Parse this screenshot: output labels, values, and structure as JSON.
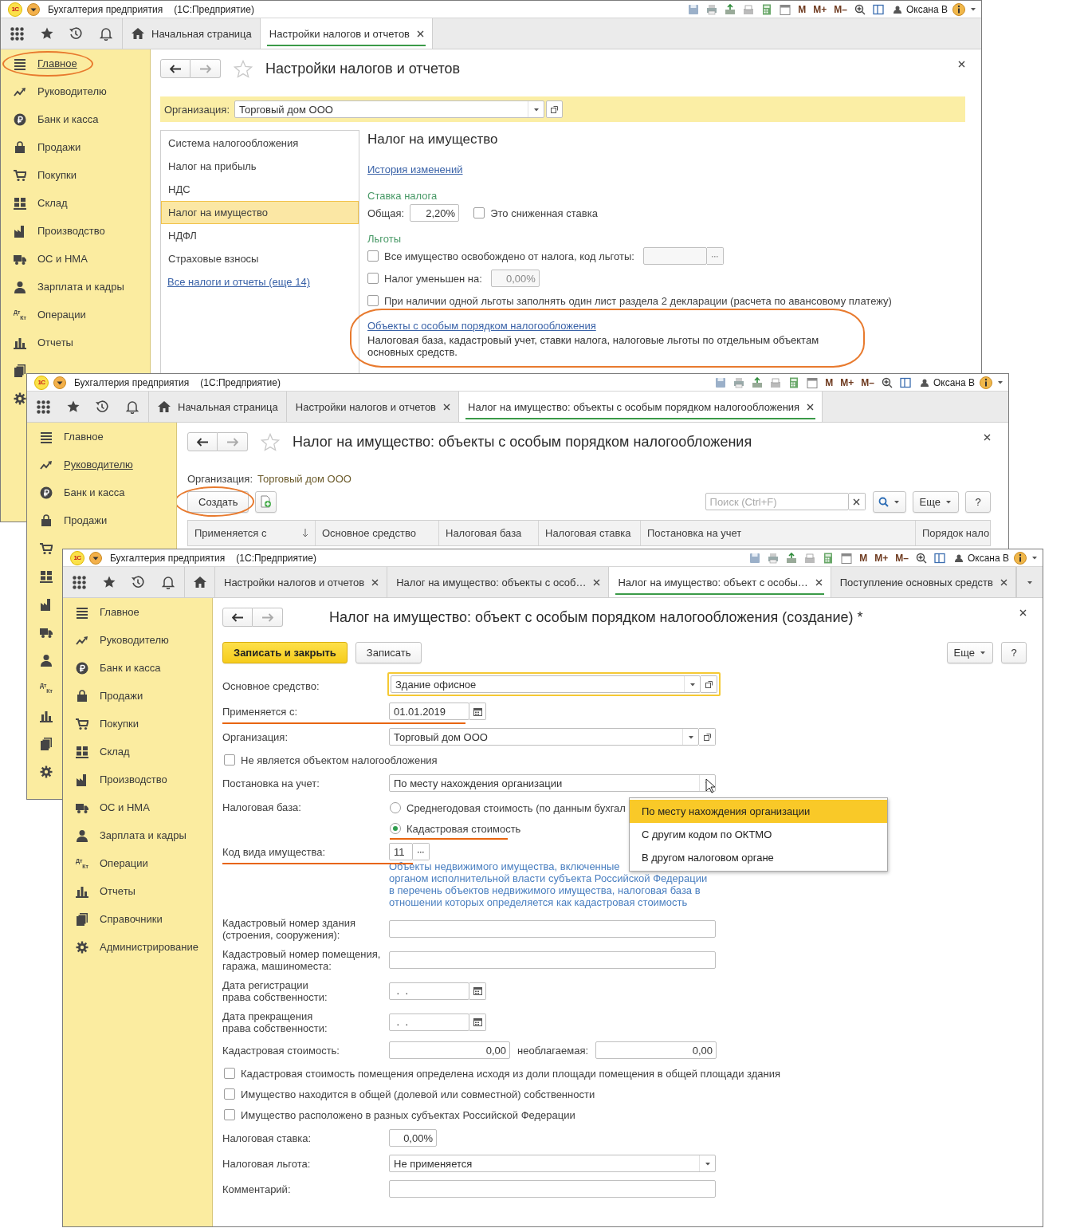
{
  "windows": [
    {
      "logo": "1С",
      "app_name": "Бухгалтерия предприятия",
      "platform": "(1С:Предприятие)",
      "memory_buttons": [
        "M",
        "M+",
        "M–"
      ],
      "user": "Оксана В",
      "tabs": [
        {
          "kind": "home",
          "label": "Начальная страница",
          "selected": false
        },
        {
          "kind": "page",
          "label": "Настройки налогов и отчетов",
          "selected": true,
          "closable": true
        }
      ],
      "sidebar": [
        {
          "kind": "main",
          "label": "Главное",
          "selected": true,
          "highlighted": true
        },
        {
          "kind": "director",
          "label": "Руководителю",
          "selected": false,
          "highlighted": false
        },
        {
          "kind": "bank",
          "label": "Банк и касса",
          "selected": false,
          "highlighted": false
        },
        {
          "kind": "sales",
          "label": "Продажи",
          "selected": false,
          "highlighted": false
        },
        {
          "kind": "purchases",
          "label": "Покупки",
          "selected": false,
          "highlighted": false
        },
        {
          "kind": "warehouse",
          "label": "Склад",
          "selected": false,
          "highlighted": false
        },
        {
          "kind": "production",
          "label": "Производство",
          "selected": false,
          "highlighted": false
        },
        {
          "kind": "assets",
          "label": "ОС и НМА",
          "selected": false,
          "highlighted": false
        },
        {
          "kind": "salary",
          "label": "Зарплата и кадры",
          "selected": false,
          "highlighted": false
        },
        {
          "kind": "operations",
          "icon_text": [
            "Дт",
            "Кт"
          ],
          "label": "Операции",
          "selected": false,
          "highlighted": false
        },
        {
          "kind": "reports",
          "label": "Отчеты",
          "selected": false,
          "highlighted": false
        },
        {
          "kind": "catalogs",
          "selected": false,
          "highlighted": false
        },
        {
          "kind": "admin",
          "selected": false,
          "highlighted": false
        }
      ],
      "content": {
        "kind": "settings",
        "title": "Настройки налогов и отчетов",
        "favorite_star": true,
        "org_label": "Организация:",
        "org_value": "Торговый дом ООО",
        "nav": [
          {
            "label": "Система налогообложения",
            "selected": false
          },
          {
            "label": "Налог на прибыль",
            "selected": false
          },
          {
            "label": "НДС",
            "selected": false
          },
          {
            "label": "Налог на имущество",
            "selected": true
          },
          {
            "label": "НДФЛ",
            "selected": false
          },
          {
            "label": "Страховые взносы",
            "selected": false
          }
        ],
        "nav_link": "Все налоги и отчеты (еще 14)",
        "section_title": "Налог на имущество",
        "history_link": "История изменений",
        "rate_group": "Ставка налога",
        "rate_label": "Общая:",
        "rate_value": "2,20%",
        "reduced": {
          "label": "Это сниженная ставка",
          "checked": false
        },
        "benefits_group": "Льготы",
        "exempt": {
          "label": "Все имущество освобождено от налога, код льготы:",
          "checked": false
        },
        "reduced_by": {
          "label": "Налог уменьшен на:",
          "checked": false,
          "value": "0,00%"
        },
        "single_sheet": {
          "label": "При наличии одной льготы заполнять один лист раздела 2 декларации (расчета по авансовому платежу)",
          "checked": false
        },
        "objects_link": "Объекты с особым порядком налогообложения",
        "objects_note": "Налоговая база, кадастровый учет, ставки налога, налоговые льготы по отдельным объектам основных средств.",
        "objects_highlighted": true
      }
    },
    {
      "logo": "1С",
      "app_name": "Бухгалтерия предприятия",
      "platform": "(1С:Предприятие)",
      "memory_buttons": [
        "M",
        "M+",
        "M–"
      ],
      "user": "Оксана В",
      "tabs": [
        {
          "kind": "home",
          "label": "Начальная страница",
          "selected": false
        },
        {
          "kind": "page",
          "label": "Настройки налогов и отчетов",
          "selected": false,
          "closable": true
        },
        {
          "kind": "page",
          "label": "Налог на имущество: объекты с особым порядком налогообложения",
          "selected": true,
          "closable": true
        }
      ],
      "sidebar": [
        {
          "kind": "main",
          "label": "Главное",
          "selected": false,
          "highlighted": false
        },
        {
          "kind": "director",
          "label": "Руководителю",
          "selected": true,
          "highlighted": false
        },
        {
          "kind": "bank",
          "label": "Банк и касса",
          "selected": false,
          "highlighted": false
        },
        {
          "kind": "sales",
          "label": "Продажи",
          "selected": false,
          "highlighted": false
        },
        {
          "kind": "purchases",
          "selected": false,
          "highlighted": false
        },
        {
          "kind": "warehouse",
          "selected": false,
          "highlighted": false
        },
        {
          "kind": "production",
          "selected": false,
          "highlighted": false
        },
        {
          "kind": "assets",
          "selected": false,
          "highlighted": false
        },
        {
          "kind": "salary",
          "selected": false,
          "highlighted": false
        },
        {
          "kind": "operations",
          "icon_text": [
            "Дт",
            "Кт"
          ],
          "selected": false,
          "highlighted": false
        },
        {
          "kind": "reports",
          "selected": false,
          "highlighted": false
        },
        {
          "kind": "catalogs",
          "selected": false,
          "highlighted": false
        },
        {
          "kind": "admin",
          "selected": false,
          "highlighted": false
        }
      ],
      "content": {
        "kind": "list",
        "title": "Налог на имущество: объекты с особым порядком налогообложения",
        "favorite_star": true,
        "org_label": "Организация:",
        "org_value": "Торговый дом ООО",
        "create_button": "Создать",
        "create_highlighted": true,
        "search_placeholder": "Поиск (Ctrl+F)",
        "more_button": "Еще",
        "help_button": "?",
        "columns": [
          {
            "label": "Применяется с",
            "sorted": true
          },
          {
            "label": "Основное средство",
            "sorted": false
          },
          {
            "label": "Налоговая база",
            "sorted": false
          },
          {
            "label": "Налоговая ставка",
            "sorted": false
          },
          {
            "label": "Постановка на учет",
            "sorted": false
          },
          {
            "label": "Порядок нало",
            "sorted": false
          }
        ]
      }
    },
    {
      "logo": "1С",
      "app_name": "Бухгалтерия предприятия",
      "platform": "(1С:Предприятие)",
      "memory_buttons": [
        "M",
        "M+",
        "M–"
      ],
      "user": "Оксана В",
      "tabs": [
        {
          "kind": "home",
          "selected": false
        },
        {
          "kind": "page",
          "label": "Настройки налогов и отчетов",
          "selected": false,
          "closable": true
        },
        {
          "kind": "page",
          "label": "Налог на имущество: объекты с особ…",
          "selected": false,
          "closable": true
        },
        {
          "kind": "page",
          "label": "Налог на имущество: объект с особы…",
          "selected": true,
          "closable": true
        },
        {
          "kind": "page",
          "label": "Поступление основных средств",
          "selected": false,
          "closable": true
        },
        {
          "kind": "menu"
        }
      ],
      "sidebar": [
        {
          "kind": "main",
          "label": "Главное",
          "selected": false,
          "highlighted": false
        },
        {
          "kind": "director",
          "label": "Руководителю",
          "selected": false,
          "highlighted": false
        },
        {
          "kind": "bank",
          "label": "Банк и касса",
          "selected": false,
          "highlighted": false
        },
        {
          "kind": "sales",
          "label": "Продажи",
          "selected": false,
          "highlighted": false
        },
        {
          "kind": "purchases",
          "label": "Покупки",
          "selected": false,
          "highlighted": false
        },
        {
          "kind": "warehouse",
          "label": "Склад",
          "selected": false,
          "highlighted": false
        },
        {
          "kind": "production",
          "label": "Производство",
          "selected": false,
          "highlighted": false
        },
        {
          "kind": "assets",
          "label": "ОС и НМА",
          "selected": false,
          "highlighted": false
        },
        {
          "kind": "salary",
          "label": "Зарплата и кадры",
          "selected": false,
          "highlighted": false
        },
        {
          "kind": "operations",
          "icon_text": [
            "Дт",
            "Кт"
          ],
          "label": "Операции",
          "selected": false,
          "highlighted": false
        },
        {
          "kind": "reports",
          "label": "Отчеты",
          "selected": false,
          "highlighted": false
        },
        {
          "kind": "catalogs",
          "label": "Справочники",
          "selected": false,
          "highlighted": false
        },
        {
          "kind": "admin",
          "label": "Администрирование",
          "selected": false,
          "highlighted": false
        }
      ],
      "content": {
        "kind": "form",
        "title": "Налог на имущество: объект с особым порядком налогообложения (создание) *",
        "favorite_star": false,
        "save_close_button": "Записать и закрыть",
        "save_button": "Записать",
        "more_button": "Еще",
        "help_button": "?",
        "rows": [
          {
            "kind": "select",
            "label": "Основное средство:",
            "value": "Здание офисное",
            "focused": true,
            "open_button": true,
            "expanded": false
          },
          {
            "kind": "date",
            "label": "Применяется с:",
            "value": "01.01.2019",
            "highlighted": true
          },
          {
            "kind": "select",
            "label": "Организация:",
            "value": "Торговый дом ООО",
            "focused": false,
            "open_button": true,
            "expanded": false
          },
          {
            "kind": "checkbox",
            "label": "Не является объектом налогообложения",
            "checked": false
          },
          {
            "kind": "select",
            "label": "Постановка на учет:",
            "value": "По месту нахождения организации",
            "focused": false,
            "open_button": false,
            "expanded": true,
            "options": [
              {
                "label": "По месту нахождения организации",
                "selected": true
              },
              {
                "label": "С другим кодом по ОКТМО",
                "selected": false
              },
              {
                "label": "В другом налоговом органе",
                "selected": false
              }
            ]
          },
          {
            "kind": "radio",
            "label": "Налоговая база:",
            "options": [
              {
                "label": "Среднегодовая стоимость (по данным бухгал",
                "selected": false,
                "highlighted": false
              },
              {
                "label": "Кадастровая стоимость",
                "selected": true,
                "highlighted": true
              }
            ]
          },
          {
            "kind": "code",
            "label": "Код вида имущества:",
            "value": "11",
            "highlighted": true,
            "help": [
              "Объекты недвижимого имущества, включенные",
              "органом исполнительной власти субъекта Российской Федерации",
              "в перечень объектов недвижимого имущества, налоговая база в",
              "отношении которых определяется как кадастровая стоимость"
            ]
          },
          {
            "kind": "text",
            "label": "Кадастровый номер здания\n(строения, сооружения):"
          },
          {
            "kind": "text",
            "label": "Кадастровый номер помещения,\nгаража, машиноместа:"
          },
          {
            "kind": "date",
            "label": "Дата регистрации\nправа собственности:",
            "value": " .  . ",
            "highlighted": false
          },
          {
            "kind": "date",
            "label": "Дата прекращения\nправа собственности:",
            "value": " .  . ",
            "highlighted": false
          },
          {
            "kind": "amount",
            "label": "Кадастровая стоимость:",
            "value": "0,00",
            "extra_label": "необлагаемая:",
            "extra_value": "0,00"
          },
          {
            "kind": "checkbox",
            "label": "Кадастровая стоимость помещения определена исходя из доли площади помещения в общей площади здания",
            "checked": false
          },
          {
            "kind": "checkbox",
            "label": "Имущество находится в общей (долевой или совместной) собственности",
            "checked": false
          },
          {
            "kind": "checkbox",
            "label": "Имущество расположено в разных субъектах Российской Федерации",
            "checked": false
          },
          {
            "kind": "number",
            "label": "Налоговая ставка:",
            "value": "0,00%"
          },
          {
            "kind": "select",
            "label": "Налоговая льгота:",
            "value": "Не применяется",
            "focused": false,
            "open_button": false,
            "expanded": false
          },
          {
            "kind": "text",
            "label": "Комментарий:"
          }
        ]
      }
    }
  ]
}
